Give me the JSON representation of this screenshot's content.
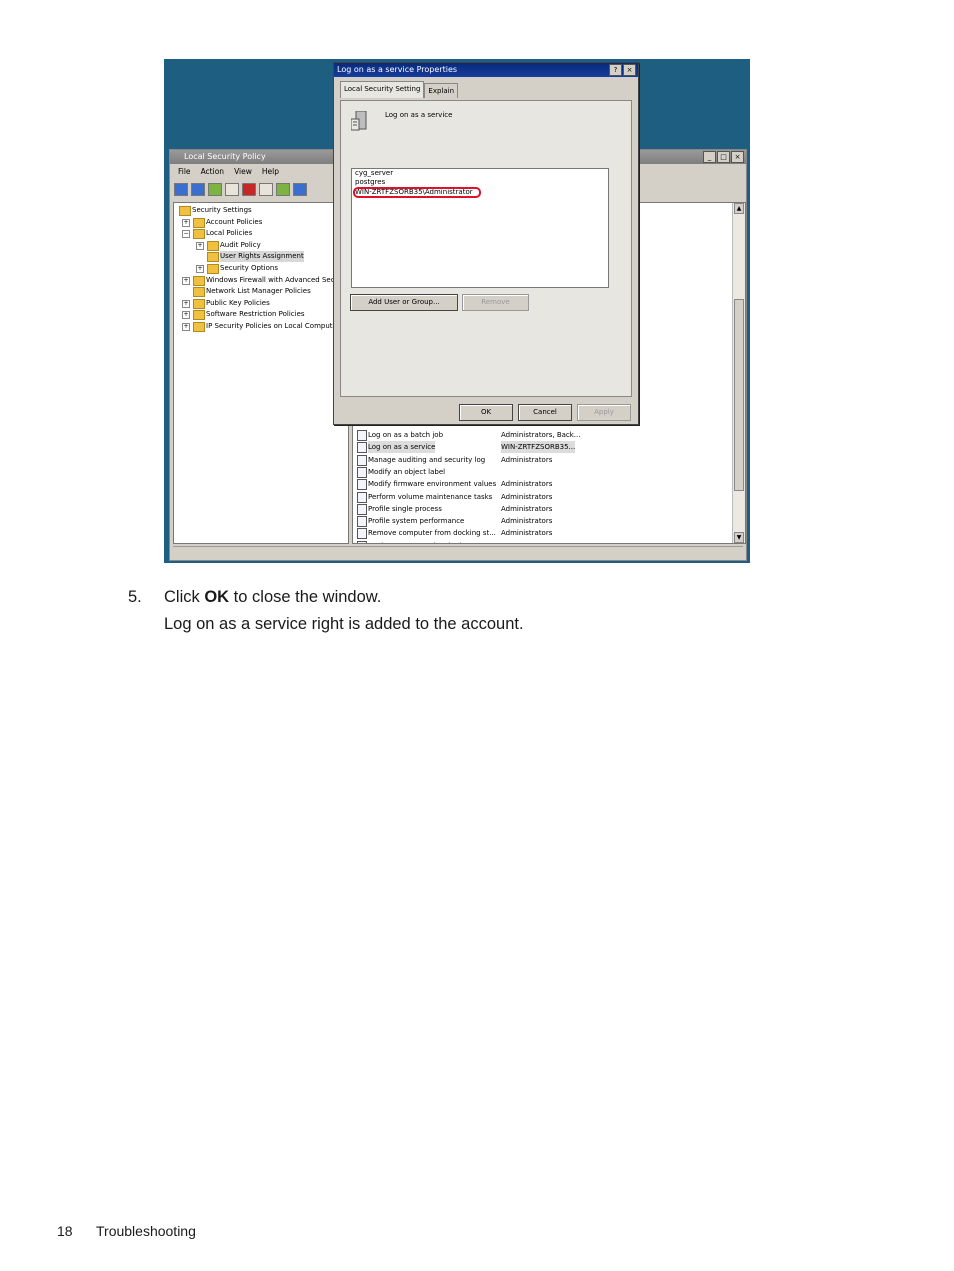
{
  "screenshot": {
    "main_window": {
      "title": "Local Security Policy",
      "menu": [
        "File",
        "Action",
        "View",
        "Help"
      ],
      "tree": [
        {
          "label": "Security Settings",
          "level": 0,
          "expander": ""
        },
        {
          "label": "Account Policies",
          "level": 1,
          "expander": "+"
        },
        {
          "label": "Local Policies",
          "level": 1,
          "expander": "−"
        },
        {
          "label": "Audit Policy",
          "level": 2,
          "expander": "+"
        },
        {
          "label": "User Rights Assignment",
          "level": 2,
          "expander": "",
          "selected": true
        },
        {
          "label": "Security Options",
          "level": 2,
          "expander": "+"
        },
        {
          "label": "Windows Firewall with Advanced Sec...",
          "level": 1,
          "expander": "+"
        },
        {
          "label": "Network List Manager Policies",
          "level": 1,
          "expander": ""
        },
        {
          "label": "Public Key Policies",
          "level": 1,
          "expander": "+"
        },
        {
          "label": "Software Restriction Policies",
          "level": 1,
          "expander": "+"
        },
        {
          "label": "IP Security Policies on Local Computer",
          "level": 1,
          "expander": "+"
        }
      ],
      "policies": [
        {
          "name": "Log on as a batch job",
          "value": "Administrators, Back..."
        },
        {
          "name": "Log on as a service",
          "value": "WIN-ZRTFZSORB35...",
          "selected": true
        },
        {
          "name": "Manage auditing and security log",
          "value": "Administrators"
        },
        {
          "name": "Modify an object label",
          "value": ""
        },
        {
          "name": "Modify firmware environment values",
          "value": "Administrators"
        },
        {
          "name": "Perform volume maintenance tasks",
          "value": "Administrators"
        },
        {
          "name": "Profile single process",
          "value": "Administrators"
        },
        {
          "name": "Profile system performance",
          "value": "Administrators"
        },
        {
          "name": "Remove computer from docking st...",
          "value": "Administrators"
        },
        {
          "name": "Replace a process level token",
          "value": "LOCAL SERVICE,NE..."
        }
      ]
    },
    "dialog": {
      "title": "Log on as a service Properties",
      "title_buttons": [
        "?",
        "×"
      ],
      "tabs": [
        "Local Security Setting",
        "Explain"
      ],
      "policy_name": "Log on as a service",
      "accounts": [
        "cyg_server",
        "postgres",
        "WIN-ZRTFZSORB35\\Administrator"
      ],
      "highlighted_account_index": 2,
      "add_button": "Add User or Group...",
      "remove_button": "Remove",
      "ok_button": "OK",
      "cancel_button": "Cancel",
      "apply_button": "Apply"
    },
    "colors": {
      "desktop": "#1e5e80",
      "highlight_ring": "#e0102a",
      "active_title": "#0a2a7a"
    }
  },
  "step": {
    "number": "5.",
    "text_before": "Click ",
    "text_bold": "OK",
    "text_after": " to close the window.",
    "result": "Log on as a service right is added to the account."
  },
  "footer": {
    "page_number": "18",
    "section": "Troubleshooting"
  }
}
